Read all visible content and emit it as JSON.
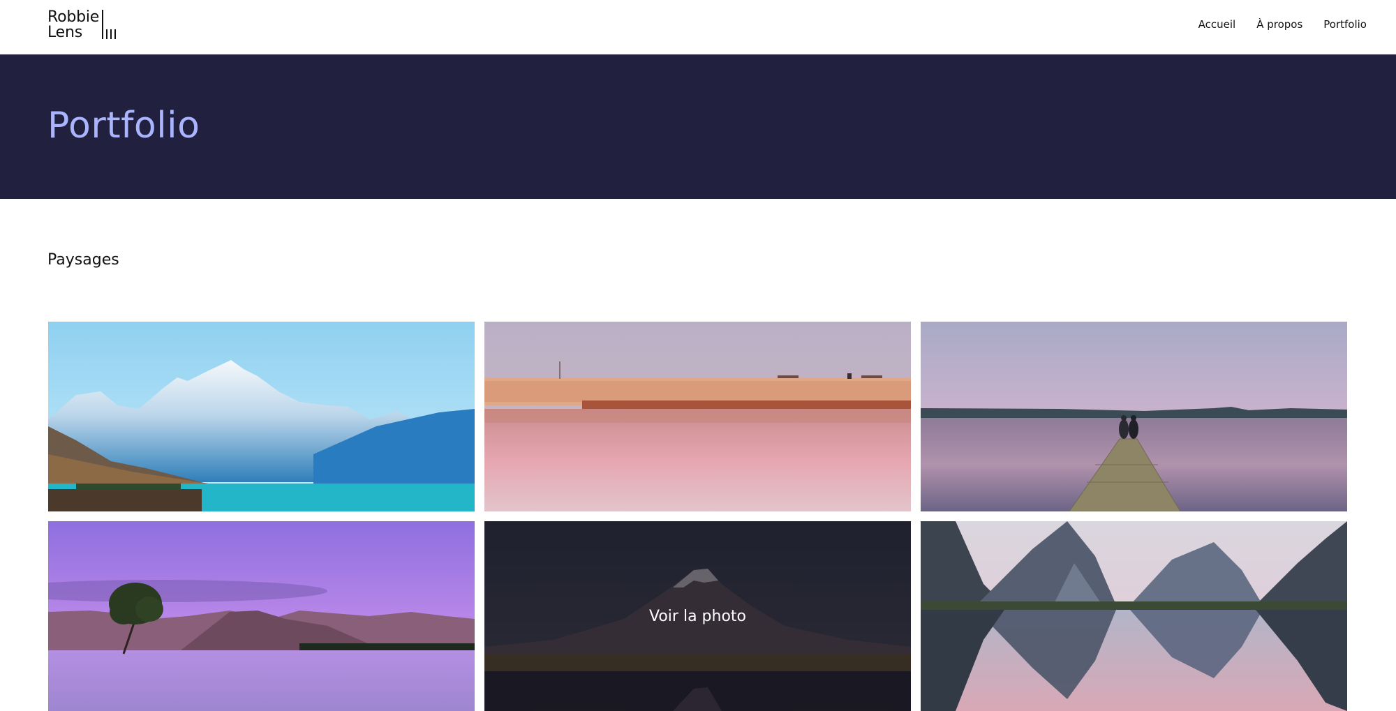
{
  "header": {
    "logo": {
      "line1": "Robbie",
      "line2": "Lens"
    },
    "nav": [
      {
        "label": "Accueil"
      },
      {
        "label": "À propos"
      },
      {
        "label": "Portfolio"
      }
    ]
  },
  "hero": {
    "title": "Portfolio"
  },
  "section": {
    "title": "Paysages"
  },
  "gallery": {
    "hover_label": "Voir la photo",
    "photos": [
      {
        "subject": "snowy-mountain-turquoise-lake"
      },
      {
        "subject": "pink-beach-reflection"
      },
      {
        "subject": "couple-on-jetty-sunset"
      },
      {
        "subject": "lone-tree-in-lake-purple-sky"
      },
      {
        "subject": "volcano-dusk"
      },
      {
        "subject": "fjord-mountains-reflection"
      }
    ]
  },
  "colors": {
    "hero_bg": "#21213f",
    "hero_title": "#aab4ff"
  }
}
